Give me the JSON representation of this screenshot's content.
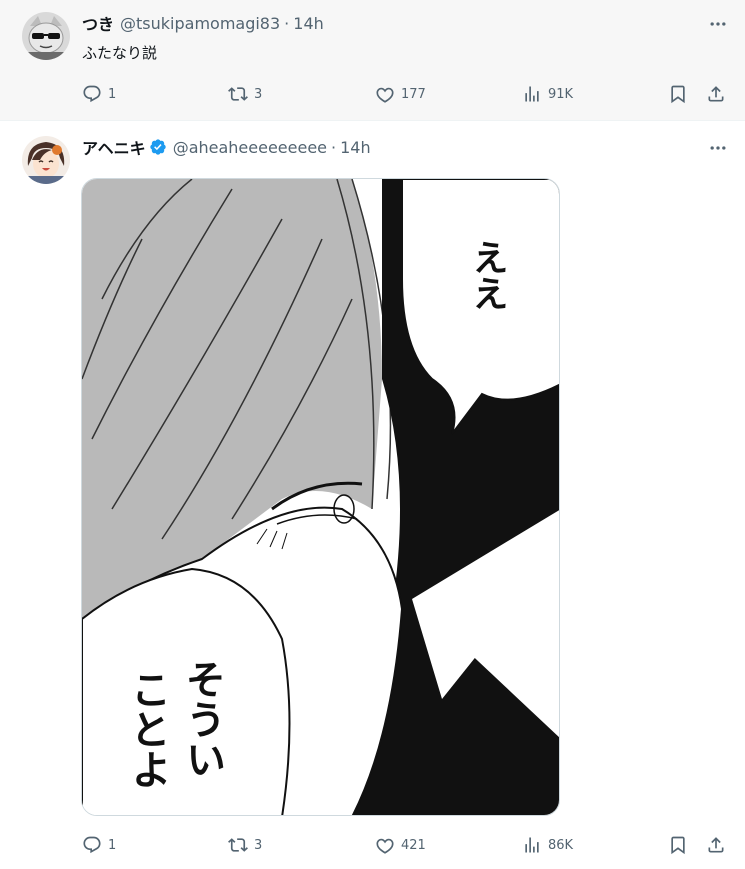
{
  "tweets": [
    {
      "name": "つき",
      "handle": "@tsukipamomagi83",
      "separator": "·",
      "time": "14h",
      "text": "ふたなり説",
      "stats": {
        "replies": "1",
        "reposts": "3",
        "likes": "177",
        "views": "91K"
      }
    },
    {
      "name": "アヘニキ",
      "handle": "@aheaheeeeeeeee",
      "separator": "·",
      "time": "14h",
      "verified": true,
      "media": {
        "bubble_top": "ええ",
        "bubble_bottom_col1": "そうい",
        "bubble_bottom_col2": "ことよ"
      },
      "stats": {
        "replies": "1",
        "reposts": "3",
        "likes": "421",
        "views": "86K"
      }
    }
  ],
  "colors": {
    "accent_blue": "#1d9bf0",
    "muted": "#536471",
    "text": "#0f1419",
    "thread_line": "#cfd9de"
  },
  "icons": [
    "reply-icon",
    "repost-icon",
    "like-icon",
    "views-icon",
    "bookmark-icon",
    "share-icon",
    "more-icon",
    "verified-icon"
  ]
}
